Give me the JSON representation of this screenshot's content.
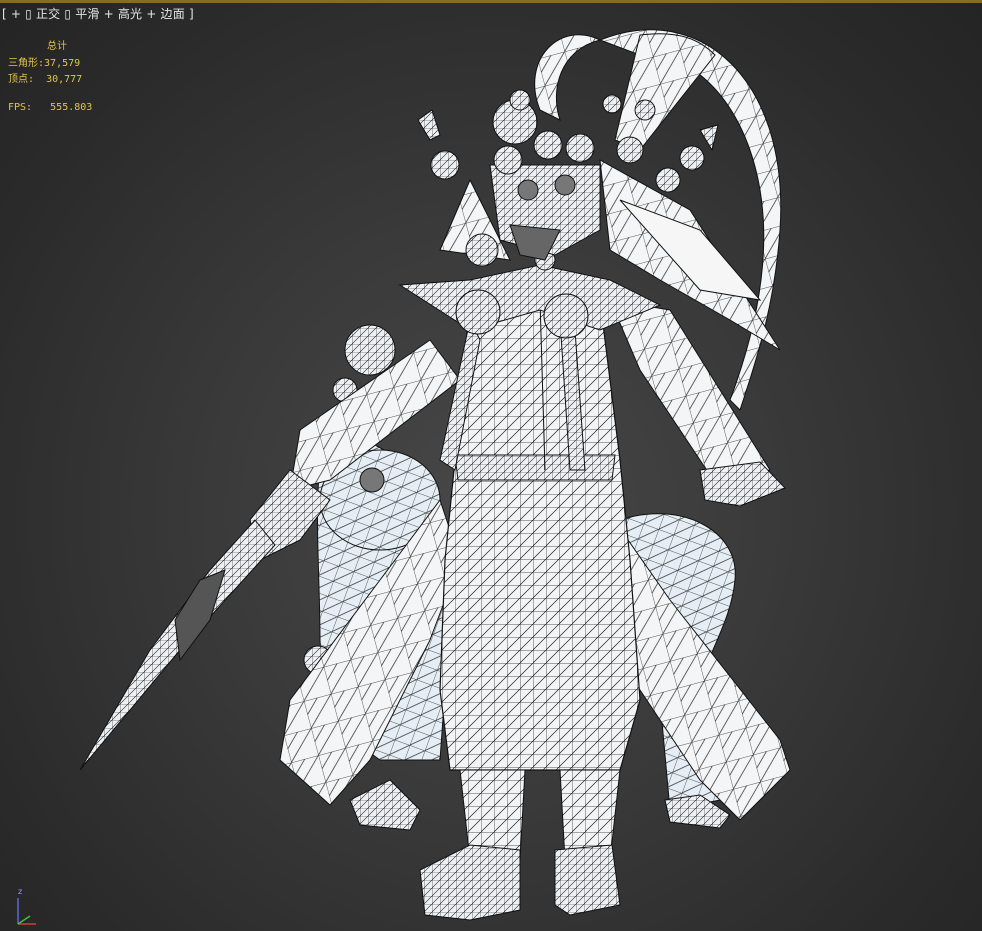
{
  "viewport": {
    "label_items": [
      "[",
      "+",
      "▯",
      "正交",
      "▯",
      "平滑",
      "+",
      "高光",
      "+",
      "边面",
      "]"
    ],
    "background": "#3c3c3c"
  },
  "statistics": {
    "title": "总计",
    "triangles_label": "三角形:",
    "triangles_value": "37,579",
    "vertices_label": "顶点:",
    "vertices_value": "30,777",
    "fps_label": "FPS:",
    "fps_value": "555.803",
    "text_color": "#e2c64a"
  },
  "model": {
    "display_mode": "smooth + highlights + edged faces",
    "fill_color": "#f2f4f6",
    "edge_color": "#1a1a1a"
  },
  "axis_gizmo": {
    "z_label": "z",
    "x_color": "#d23c3c",
    "y_color": "#3cc83c",
    "z_color": "#5a6ee6"
  }
}
